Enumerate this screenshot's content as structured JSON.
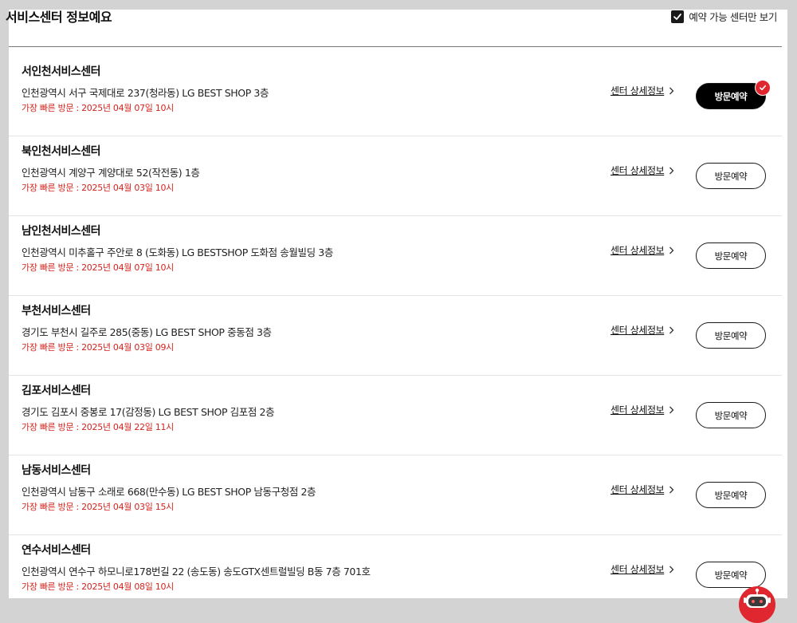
{
  "header": {
    "title": "서비스센터 정보예요",
    "filter_label": "예약 가능 센터만 보기",
    "filter_checked": true
  },
  "row_labels": {
    "detail": "센터 상세정보",
    "reserve": "방문예약"
  },
  "centers": [
    {
      "name": "서인천서비스센터",
      "address": "인천광역시 서구 국제대로 237(청라동) LG BEST SHOP 3층",
      "earliest": "가장 빠른 방문 : 2025년 04월 07일 10시",
      "selected": true
    },
    {
      "name": "북인천서비스센터",
      "address": "인천광역시 계양구 계양대로 52(작전동) 1층",
      "earliest": "가장 빠른 방문 : 2025년 04월 03일 10시",
      "selected": false
    },
    {
      "name": "남인천서비스센터",
      "address": "인천광역시 미추홀구 주안로 8 (도화동) LG BESTSHOP 도화점 송월빌딩 3층",
      "earliest": "가장 빠른 방문 : 2025년 04월 07일 10시",
      "selected": false
    },
    {
      "name": "부천서비스센터",
      "address": "경기도 부천시 길주로 285(중동) LG BEST SHOP 중동점 3층",
      "earliest": "가장 빠른 방문 : 2025년 04월 03일 09시",
      "selected": false
    },
    {
      "name": "김포서비스센터",
      "address": "경기도 김포시 중봉로 17(감정동) LG BEST SHOP 김포점 2층",
      "earliest": "가장 빠른 방문 : 2025년 04월 22일 11시",
      "selected": false
    },
    {
      "name": "남동서비스센터",
      "address": "인천광역시 남동구 소래로 668(만수동) LG BEST SHOP 남동구청점 2층",
      "earliest": "가장 빠른 방문 : 2025년 04월 03일 15시",
      "selected": false
    },
    {
      "name": "연수서비스센터",
      "address": "인천광역시 연수구 하모니로178번길 22 (송도동) 송도GTX센트럴빌딩 B동 7층 701호",
      "earliest": "가장 빠른 방문 : 2025년 04월 08일 10시",
      "selected": false
    }
  ],
  "colors": {
    "accent_red": "#d4231d",
    "badge_red": "#e0262e",
    "selected_button": "#000000"
  },
  "icons": {
    "filter_checkbox": "checkmark-icon",
    "detail_arrow": "chevron-right-icon",
    "selected_badge": "check-badge-icon",
    "chatbot": "chatbot-robot-icon"
  }
}
